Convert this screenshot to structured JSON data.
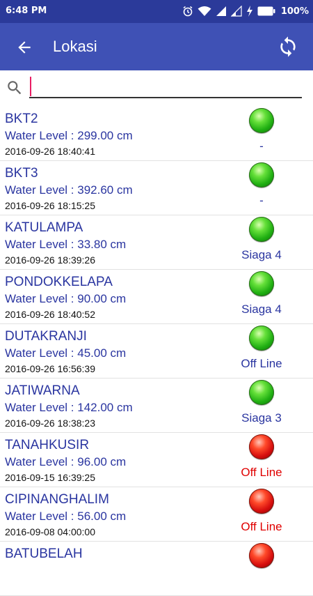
{
  "status_bar": {
    "time": "6:48 PM",
    "battery": "100%"
  },
  "appbar": {
    "title": "Lokasi",
    "back_icon": "arrow-back-icon",
    "refresh_icon": "refresh-icon"
  },
  "search": {
    "value": "",
    "placeholder": "",
    "icon": "search-icon"
  },
  "colors": {
    "primary": "#3f51b5",
    "status_bar": "#2b3a9a",
    "text_blue": "#2a35a0",
    "alert_red": "#e00000",
    "caret": "#e91e63"
  },
  "locations": [
    {
      "name": "BKT2",
      "level": "Water Level : 299.00 cm",
      "timestamp": "2016-09-26 18:40:41",
      "lamp": "green",
      "status": "-",
      "status_color": "blue"
    },
    {
      "name": "BKT3",
      "level": "Water Level : 392.60 cm",
      "timestamp": "2016-09-26 18:15:25",
      "lamp": "green",
      "status": "-",
      "status_color": "blue"
    },
    {
      "name": "KATULAMPA",
      "level": "Water Level : 33.80 cm",
      "timestamp": "2016-09-26 18:39:26",
      "lamp": "green",
      "status": "Siaga 4",
      "status_color": "blue"
    },
    {
      "name": "PONDOKKELAPA",
      "level": "Water Level : 90.00 cm",
      "timestamp": "2016-09-26 18:40:52",
      "lamp": "green",
      "status": "Siaga 4",
      "status_color": "blue"
    },
    {
      "name": "DUTAKRANJI",
      "level": "Water Level : 45.00 cm",
      "timestamp": "2016-09-26 16:56:39",
      "lamp": "green",
      "status": "Off Line",
      "status_color": "blue"
    },
    {
      "name": "JATIWARNA",
      "level": "Water Level : 142.00 cm",
      "timestamp": "2016-09-26 18:38:23",
      "lamp": "green",
      "status": "Siaga 3",
      "status_color": "blue"
    },
    {
      "name": "TANAHKUSIR",
      "level": "Water Level : 96.00 cm",
      "timestamp": "2016-09-15 16:39:25",
      "lamp": "red",
      "status": "Off Line",
      "status_color": "red"
    },
    {
      "name": "CIPINANGHALIM",
      "level": "Water Level : 56.00 cm",
      "timestamp": "2016-09-08 04:00:00",
      "lamp": "red",
      "status": "Off Line",
      "status_color": "red"
    },
    {
      "name": "BATUBELAH",
      "level": "",
      "timestamp": "",
      "lamp": "red",
      "status": "",
      "status_color": "red"
    }
  ]
}
